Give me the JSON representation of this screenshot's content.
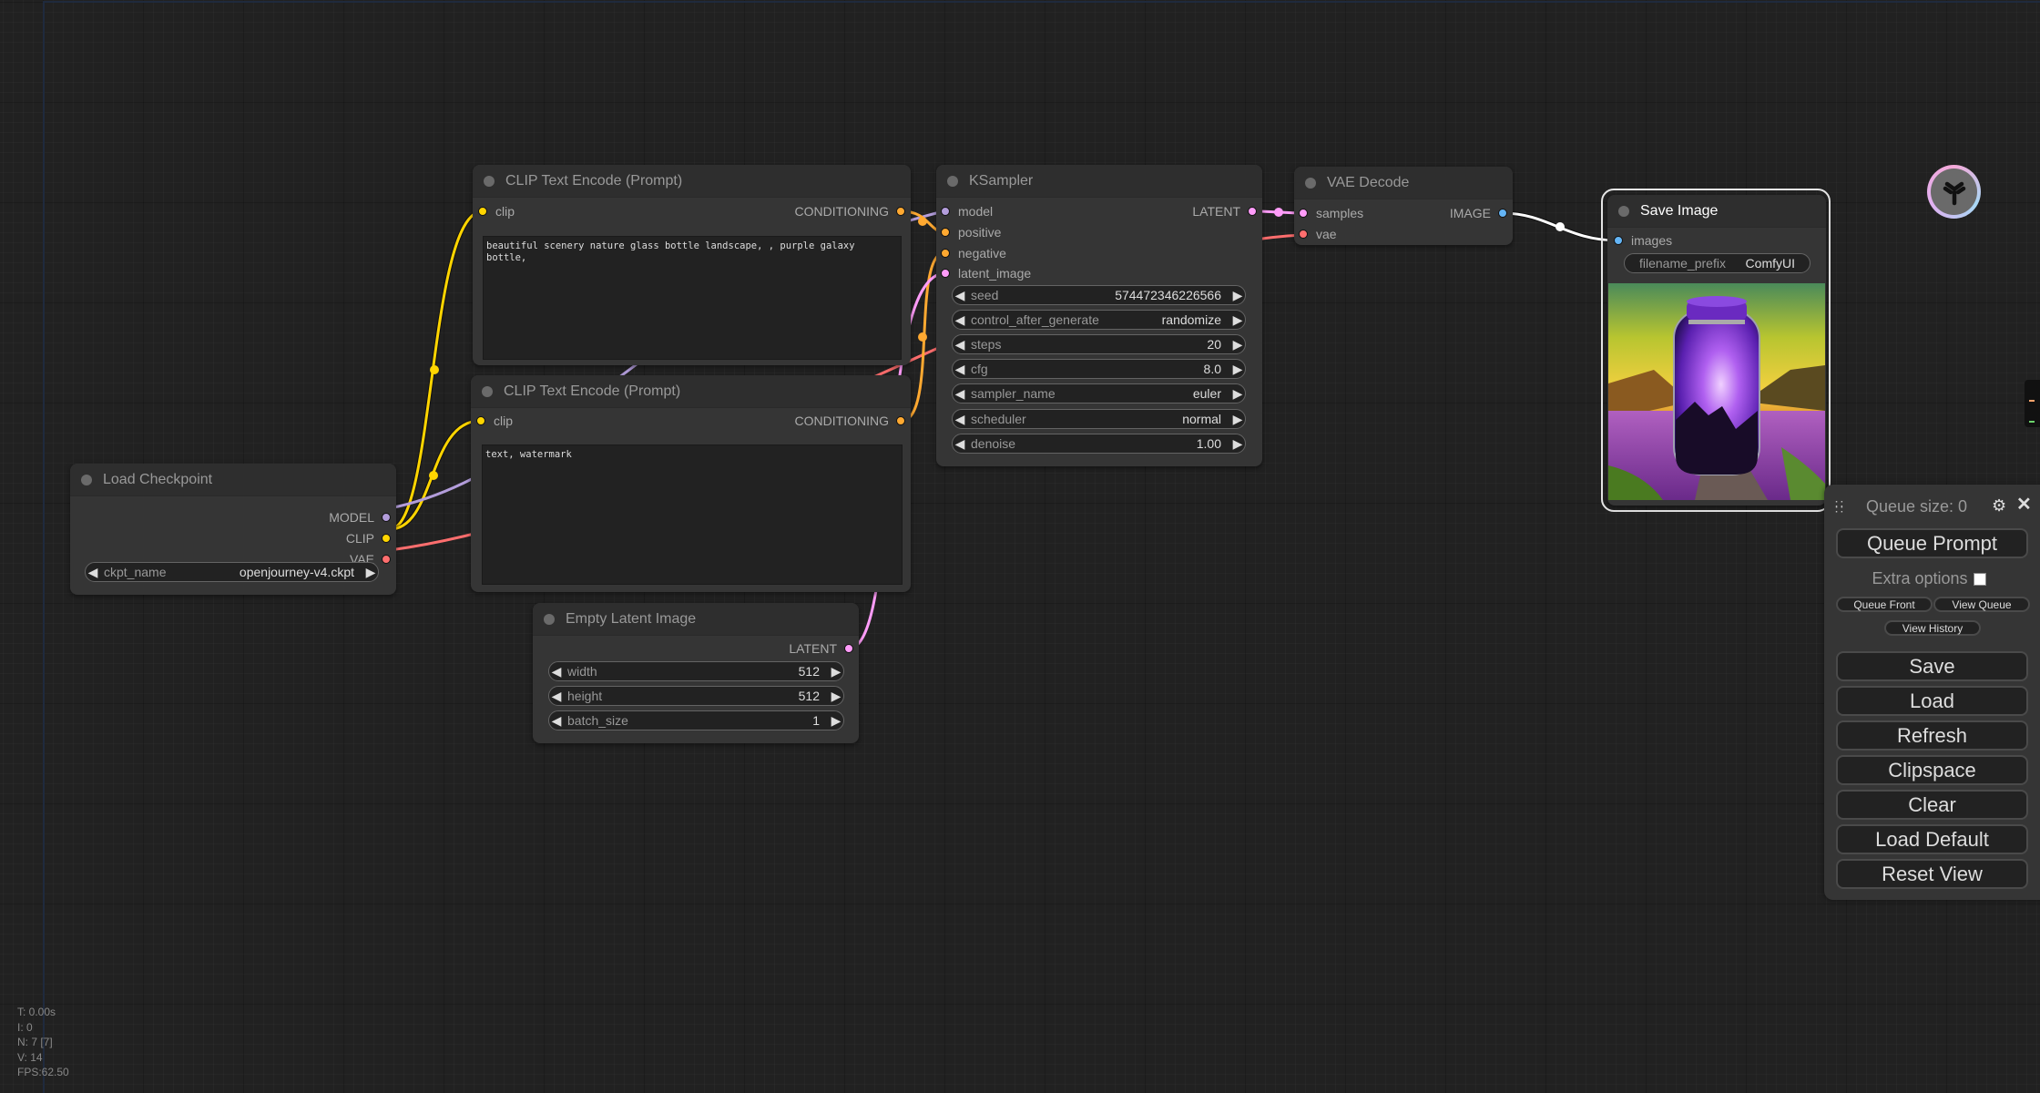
{
  "nodes": {
    "load_checkpoint": {
      "title": "Load Checkpoint",
      "outputs": [
        "MODEL",
        "CLIP",
        "VAE"
      ],
      "widget": {
        "label": "ckpt_name",
        "value": "openjourney-v4.ckpt"
      }
    },
    "clip_positive": {
      "title": "CLIP Text Encode (Prompt)",
      "input": "clip",
      "output": "CONDITIONING",
      "text": "beautiful scenery nature glass bottle landscape, , purple galaxy bottle,"
    },
    "clip_negative": {
      "title": "CLIP Text Encode (Prompt)",
      "input": "clip",
      "output": "CONDITIONING",
      "text": "text, watermark"
    },
    "empty_latent": {
      "title": "Empty Latent Image",
      "output": "LATENT",
      "widgets": [
        {
          "label": "width",
          "value": "512"
        },
        {
          "label": "height",
          "value": "512"
        },
        {
          "label": "batch_size",
          "value": "1"
        }
      ]
    },
    "ksampler": {
      "title": "KSampler",
      "inputs": [
        "model",
        "positive",
        "negative",
        "latent_image"
      ],
      "output": "LATENT",
      "widgets": [
        {
          "label": "seed",
          "value": "574472346226566"
        },
        {
          "label": "control_after_generate",
          "value": "randomize"
        },
        {
          "label": "steps",
          "value": "20"
        },
        {
          "label": "cfg",
          "value": "8.0"
        },
        {
          "label": "sampler_name",
          "value": "euler"
        },
        {
          "label": "scheduler",
          "value": "normal"
        },
        {
          "label": "denoise",
          "value": "1.00"
        }
      ]
    },
    "vae_decode": {
      "title": "VAE Decode",
      "inputs": [
        "samples",
        "vae"
      ],
      "output": "IMAGE"
    },
    "save_image": {
      "title": "Save Image",
      "input": "images",
      "widget": {
        "label": "filename_prefix",
        "value": "ComfyUI"
      },
      "preview_alt": "glass jar containing purple galaxy on a road through lavender fields"
    }
  },
  "slot_colors": {
    "MODEL": "#b39ddb",
    "CLIP": "#ffd500",
    "VAE": "#ff6e6e",
    "CONDITIONING": "#ffa931",
    "LATENT": "#ff9cf9",
    "IMAGE": "#64b5f6"
  },
  "stats": {
    "t": "T: 0.00s",
    "i": "I: 0",
    "n": "N: 7 [7]",
    "v": "V: 14",
    "fps": "FPS:62.50"
  },
  "queue_panel": {
    "queue_size_label": "Queue size: 0",
    "queue_prompt": "Queue Prompt",
    "extra_options": "Extra options",
    "extra_options_checked": false,
    "queue_front": "Queue Front",
    "view_queue": "View Queue",
    "view_history": "View History",
    "buttons": [
      "Save",
      "Load",
      "Refresh",
      "Clipspace",
      "Clear",
      "Load Default",
      "Reset View"
    ]
  }
}
